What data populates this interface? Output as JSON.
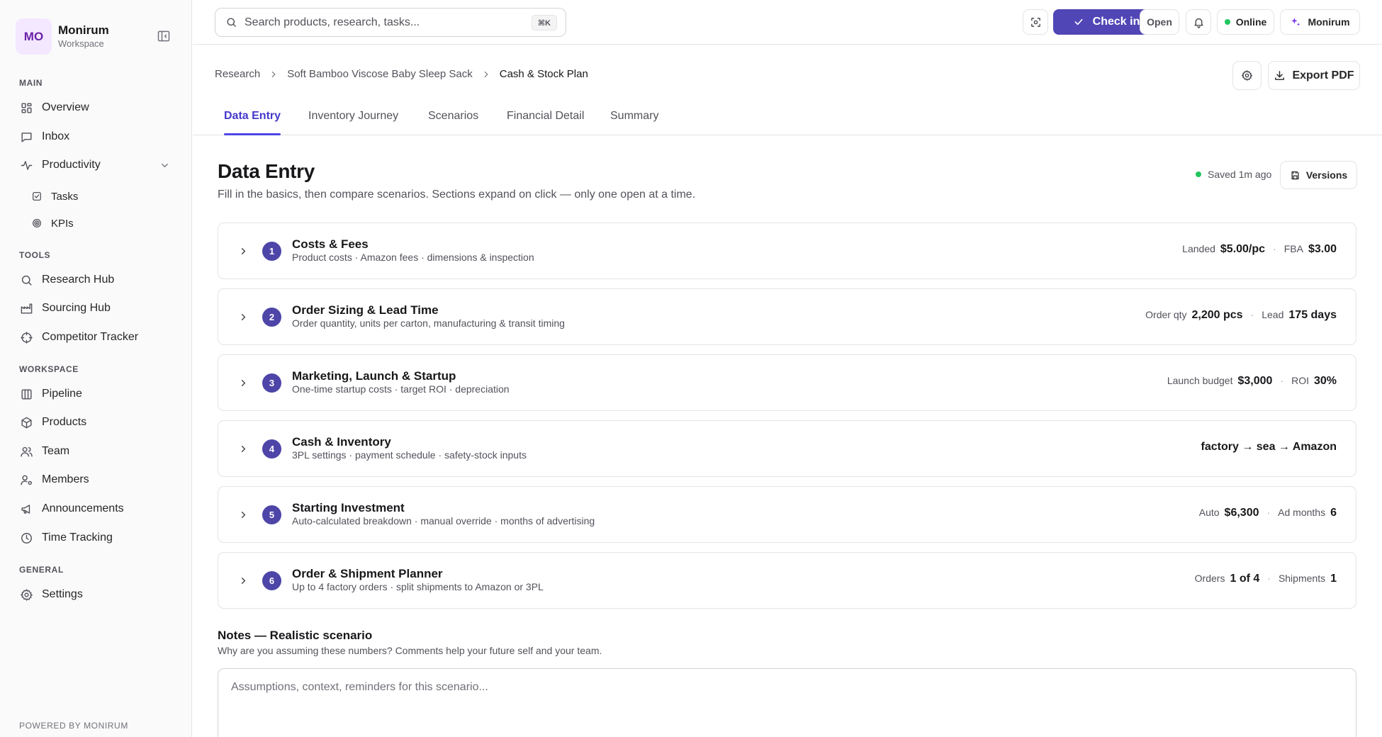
{
  "workspace": {
    "initials": "MO",
    "name": "Monirum",
    "subtitle": "Workspace"
  },
  "sidebar": {
    "main_label": "MAIN",
    "tools_label": "TOOLS",
    "workspace_label": "WORKSPACE",
    "general_label": "GENERAL",
    "overview": "Overview",
    "inbox": "Inbox",
    "productivity": "Productivity",
    "tasks": "Tasks",
    "kpis": "KPIs",
    "research_hub": "Research Hub",
    "sourcing_hub": "Sourcing Hub",
    "competitor_tracker": "Competitor Tracker",
    "pipeline": "Pipeline",
    "products": "Products",
    "team": "Team",
    "members": "Members",
    "announcements": "Announcements",
    "time_tracking": "Time Tracking",
    "settings": "Settings",
    "powered_by": "POWERED BY MONIRUM"
  },
  "topbar": {
    "search_placeholder": "Search products, research, tasks...",
    "shortcut": "⌘K",
    "check_in": "Check in",
    "open": "Open",
    "status": "Online",
    "user": "Monirum"
  },
  "breadcrumb": [
    "Research",
    "Soft Bamboo Viscose Baby Sleep Sack",
    "Cash & Stock Plan"
  ],
  "actions": {
    "export_pdf": "Export PDF",
    "versions": "Versions"
  },
  "tabs": [
    "Data Entry",
    "Inventory Journey",
    "Scenarios",
    "Financial Detail",
    "Summary"
  ],
  "page": {
    "title": "Data Entry",
    "subtitle": "Fill in the basics, then compare scenarios. Sections expand on click — only one open at a time.",
    "saved": "Saved 1m ago"
  },
  "sections": [
    {
      "num": "1",
      "title": "Costs & Fees",
      "desc": "Product costs · Amazon fees · dimensions & inspection",
      "m1_label": "Landed",
      "m1_value": "$5.00/pc",
      "sep": "·",
      "m2_label": "FBA",
      "m2_value": "$3.00"
    },
    {
      "num": "2",
      "title": "Order Sizing & Lead Time",
      "desc": "Order quantity, units per carton, manufacturing & transit timing",
      "m1_label": "Order qty",
      "m1_value": "2,200 pcs",
      "sep": "·",
      "m2_label": "Lead",
      "m2_value": "175 days"
    },
    {
      "num": "3",
      "title": "Marketing, Launch & Startup",
      "desc": "One-time startup costs · target ROI · depreciation",
      "m1_label": "Launch budget",
      "m1_value": "$3,000",
      "sep": "·",
      "m2_label": "ROI",
      "m2_value": "30%"
    },
    {
      "num": "4",
      "title": "Cash & Inventory",
      "desc": "3PL settings · payment schedule · safety-stock inputs",
      "flow": "factory → sea → Amazon"
    },
    {
      "num": "5",
      "title": "Starting Investment",
      "desc": "Auto-calculated breakdown · manual override · months of advertising",
      "m1_label": "Auto",
      "m1_value": "$6,300",
      "sep": "·",
      "m2_label": "Ad months",
      "m2_value": "6"
    },
    {
      "num": "6",
      "title": "Order & Shipment Planner",
      "desc": "Up to 4 factory orders · split shipments to Amazon or 3PL",
      "m1_label": "Orders",
      "m1_value": "1 of 4",
      "sep": "·",
      "m2_label": "Shipments",
      "m2_value": "1"
    }
  ],
  "notes": {
    "title": "Notes — Realistic scenario",
    "subtitle": "Why are you assuming these numbers? Comments help your future self and your team.",
    "placeholder": "Assumptions, context, reminders for this scenario..."
  },
  "colors": {
    "accent": "#5146b5",
    "section_badge": "#4e45a8",
    "online": "#22c55e",
    "avatar_bg": "#f3e8ff"
  }
}
